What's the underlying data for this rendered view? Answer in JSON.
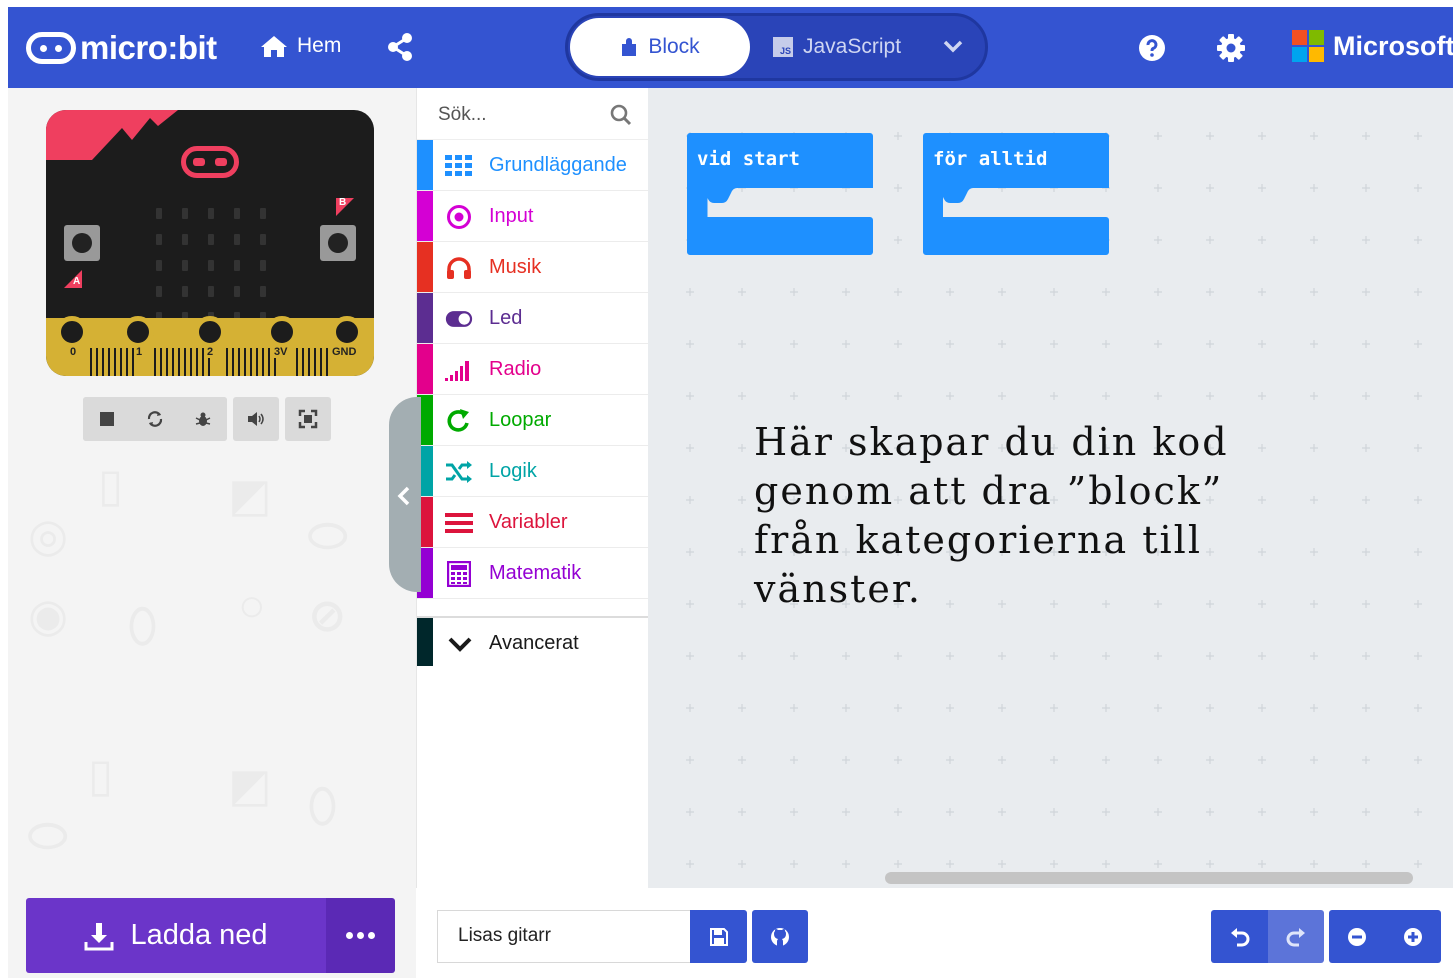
{
  "header": {
    "logo_text": "micro:bit",
    "home_label": "Hem",
    "share_icon": "share-icon",
    "mode_block_label": "Block",
    "mode_js_label": "JavaScript",
    "js_badge": "JS",
    "help_icon": "help-icon",
    "settings_icon": "gear-icon",
    "brand_label": "Microsoft",
    "colors": {
      "header_bg": "#3454d1",
      "ms_red": "#f25022",
      "ms_green": "#7fba00",
      "ms_blue": "#00a4ef",
      "ms_yellow": "#ffb900"
    }
  },
  "simulator": {
    "button_a": "A",
    "button_b": "B",
    "pins": [
      "0",
      "1",
      "2",
      "3V",
      "GND"
    ],
    "controls": [
      "stop-icon",
      "restart-icon",
      "debug-icon",
      "sound-icon",
      "fullscreen-icon"
    ]
  },
  "toolbox": {
    "search_placeholder": "Sök...",
    "categories": [
      {
        "label": "Grundläggande",
        "color": "#1e90ff",
        "icon": "grid-icon"
      },
      {
        "label": "Input",
        "color": "#d400d4",
        "icon": "target-icon"
      },
      {
        "label": "Musik",
        "color": "#e63022",
        "icon": "headphones-icon"
      },
      {
        "label": "Led",
        "color": "#5c2d91",
        "icon": "toggle-icon"
      },
      {
        "label": "Radio",
        "color": "#e3008c",
        "icon": "signal-bars-icon"
      },
      {
        "label": "Loopar",
        "color": "#00aa00",
        "icon": "loop-arrow-icon"
      },
      {
        "label": "Logik",
        "color": "#00a4a6",
        "icon": "shuffle-icon"
      },
      {
        "label": "Variabler",
        "color": "#dc143c",
        "icon": "lines-icon"
      },
      {
        "label": "Matematik",
        "color": "#9400d3",
        "icon": "calculator-icon"
      }
    ],
    "advanced_label": "Avancerat",
    "advanced_color": "#00272b"
  },
  "workspace": {
    "blocks": [
      {
        "label": "vid start",
        "color": "#1e90ff"
      },
      {
        "label": "för alltid",
        "color": "#1e90ff"
      }
    ],
    "annotation": "Här skapar du din kod genom att dra ”block” från kategorierna till vänster."
  },
  "footer": {
    "download_label": "Ladda ned",
    "project_name": "Lisas gitarr",
    "download_color": "#6b35c9"
  }
}
